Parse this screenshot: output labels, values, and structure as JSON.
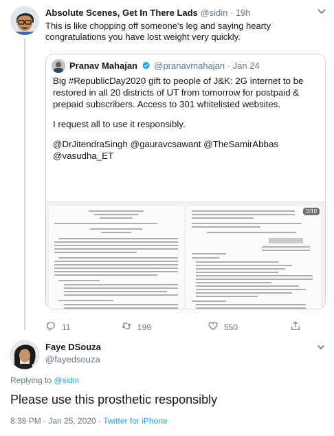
{
  "tweet": {
    "author_name": "Absolute Scenes, Get In There Lads",
    "author_handle": "@sidin",
    "time": "19h",
    "separator": "·",
    "text": "This is like chopping off someone's leg and saying hearty congratulations you have lost weight very quickly.",
    "quoted": {
      "author_name": "Pranav Mahajan",
      "author_handle": "@pranavmahajan",
      "date": "Jan 24",
      "separator": "·",
      "line1": "Big #RepublicDay2020 gift to people of J&K: 2G internet to be restored in all 20 districts of UT from tomorrow for postpaid & prepaid subscribers. Access to 301 whitelisted websites.",
      "line2": "I request all to use it responsibly.",
      "line3": "@DrJitendraSingh @gauravcsawant @TheSamirAbbas @vasudha_ET",
      "image_badge": "2/10"
    },
    "actions": {
      "replies": "11",
      "retweets": "199",
      "likes": "550"
    }
  },
  "reply": {
    "author_name": "Faye DSouza",
    "author_handle": "@fayedsouza",
    "replying_prefix": "Replying to",
    "replying_to": "@sidin",
    "text": "Please use this prosthetic responsibly",
    "timestamp": "8:38 PM · Jan 25, 2020",
    "separator": " · ",
    "source": "Twitter for iPhone"
  },
  "colors": {
    "link": "#1da1f2",
    "secondary_text": "#657786",
    "border": "#ccd6dd",
    "verified": "#1da1f2"
  },
  "icons": [
    "more-icon",
    "verified-icon",
    "reply-icon",
    "retweet-icon",
    "like-icon",
    "share-icon",
    "chevron-down-icon"
  ]
}
